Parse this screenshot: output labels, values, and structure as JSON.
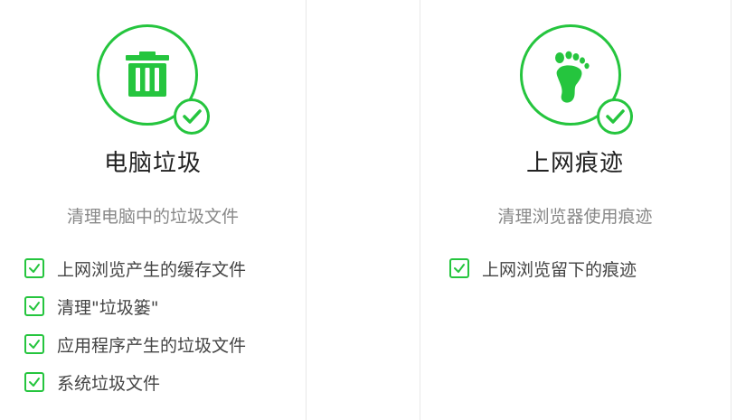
{
  "accent_color": "#25c53e",
  "cards": [
    {
      "icon": "trash-can-icon",
      "title": "电脑垃圾",
      "description": "清理电脑中的垃圾文件",
      "options": [
        {
          "label": "上网浏览产生的缓存文件",
          "checked": true
        },
        {
          "label": "清理\"垃圾篓\"",
          "checked": true
        },
        {
          "label": "应用程序产生的垃圾文件",
          "checked": true
        },
        {
          "label": "系统垃圾文件",
          "checked": true
        }
      ]
    },
    {
      "icon": "footprint-icon",
      "title": "上网痕迹",
      "description": "清理浏览器使用痕迹",
      "options": [
        {
          "label": "上网浏览留下的痕迹",
          "checked": true
        }
      ]
    }
  ]
}
